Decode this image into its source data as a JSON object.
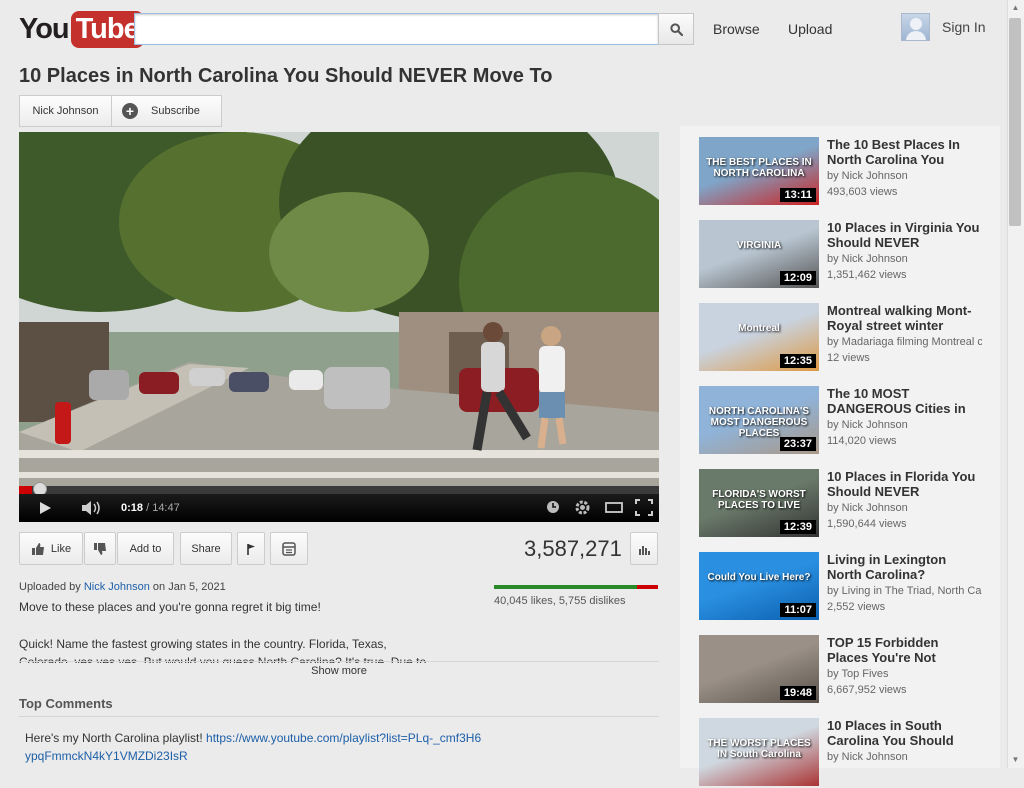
{
  "header": {
    "logo_you": "You",
    "logo_tube": "Tube",
    "search_value": "",
    "browse": "Browse",
    "upload": "Upload",
    "signin": "Sign In"
  },
  "video": {
    "title": "10 Places in North Carolina You Should NEVER Move To",
    "channel": "Nick Johnson",
    "subscribe": "Subscribe",
    "time_current": "0:18",
    "time_total": " / 14:47",
    "progress_fraction": 0.02
  },
  "actions": {
    "like": "Like",
    "add_to": "Add to",
    "share": "Share",
    "views": "3,587,271",
    "likes_text": "40,045 likes, 5,755 dislikes",
    "like_ratio": 0.874
  },
  "details": {
    "uploaded_by": "Uploaded by ",
    "uploader": "Nick Johnson",
    "upload_date": " on Jan 5, 2021",
    "desc_line1": "Move to these places and you're gonna regret it big time!",
    "desc_line2": "Quick! Name the fastest growing states in the country. Florida, Texas,",
    "desc_line3": "Colorado, yes yes yes. But would you guess North Carolina? It's true. Due to",
    "show_more": "Show more"
  },
  "comments": {
    "heading": "Top Comments",
    "first_text": "Here's my North Carolina playlist! ",
    "first_link": "https://www.youtube.com/playlist?list=PLq-_cmf3H6ypqFmmckN4kY1VMZDi23IsR"
  },
  "recommended": [
    {
      "title": "The 10 Best Places In North Carolina You",
      "by": "by Nick Johnson",
      "views": "493,603 views",
      "duration": "13:11",
      "thumb_text": "THE BEST PLACES IN NORTH CAROLINA",
      "colors": [
        "#7fa6c9",
        "#c22"
      ]
    },
    {
      "title": "10 Places in Virginia You Should NEVER",
      "by": "by Nick Johnson",
      "views": "1,351,462 views",
      "duration": "12:09",
      "thumb_text": "VIRGINIA",
      "colors": [
        "#b9c6d2",
        "#555"
      ]
    },
    {
      "title": "Montreal walking Mont-Royal street winter",
      "by": "by Madariaga filming Montreal c",
      "views": "12 views",
      "duration": "12:35",
      "thumb_text": "Montreal",
      "colors": [
        "#c9d3e0",
        "#d94"
      ]
    },
    {
      "title": "The 10 MOST DANGEROUS Cities in",
      "by": "by Nick Johnson",
      "views": "114,020 views",
      "duration": "23:37",
      "thumb_text": "NORTH CAROLINA'S MOST DANGEROUS PLACES",
      "colors": [
        "#8fb3d9",
        "#a98"
      ]
    },
    {
      "title": "10 Places in Florida You Should NEVER",
      "by": "by Nick Johnson",
      "views": "1,590,644 views",
      "duration": "12:39",
      "thumb_text": "FLORIDA'S WORST PLACES TO LIVE",
      "colors": [
        "#6a7a6a",
        "#333"
      ]
    },
    {
      "title": "Living in Lexington North Carolina?",
      "by": "by Living in The Triad, North Ca",
      "views": "2,552 views",
      "duration": "11:07",
      "thumb_text": "Could You Live Here?",
      "colors": [
        "#2a8fe0",
        "#0b5fb0"
      ]
    },
    {
      "title": "TOP 15 Forbidden Places You're Not",
      "by": "by Top Fives",
      "views": "6,667,952 views",
      "duration": "19:48",
      "thumb_text": "",
      "colors": [
        "#9a9088",
        "#5a524a"
      ]
    },
    {
      "title": "10 Places in South Carolina You Should",
      "by": "by Nick Johnson",
      "views": "",
      "duration": "",
      "thumb_text": "THE WORST PLACES IN South Carolina",
      "colors": [
        "#cfd8e0",
        "#a33"
      ]
    }
  ],
  "colors": {
    "accent_red": "#c4302b",
    "link_blue": "#1c5fa8",
    "like_green": "#2a8a2a"
  }
}
